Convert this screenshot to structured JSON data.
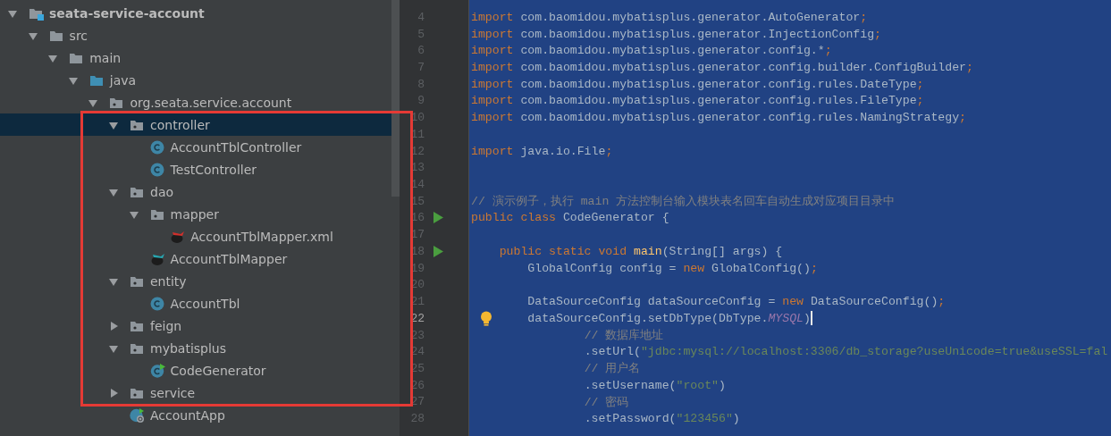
{
  "project_tree": [
    {
      "label": "seata-service-account",
      "kind": "module",
      "expanded": true,
      "selected": false,
      "children": [
        {
          "label": "src",
          "kind": "folder",
          "expanded": true,
          "selected": false,
          "children": [
            {
              "label": "main",
              "kind": "folder",
              "expanded": true,
              "selected": false,
              "children": [
                {
                  "label": "java",
                  "kind": "source-folder",
                  "expanded": true,
                  "selected": false,
                  "children": [
                    {
                      "label": "org.seata.service.account",
                      "kind": "package",
                      "expanded": true,
                      "selected": false,
                      "children": [
                        {
                          "label": "controller",
                          "kind": "package",
                          "expanded": true,
                          "selected": true,
                          "children": [
                            {
                              "label": "AccountTblController",
                              "kind": "class",
                              "selected": false
                            },
                            {
                              "label": "TestController",
                              "kind": "class",
                              "selected": false
                            }
                          ]
                        },
                        {
                          "label": "dao",
                          "kind": "package",
                          "expanded": true,
                          "selected": false,
                          "children": [
                            {
                              "label": "mapper",
                              "kind": "package",
                              "expanded": true,
                              "selected": false,
                              "children": [
                                {
                                  "label": "AccountTblMapper.xml",
                                  "kind": "mybatis-xml",
                                  "selected": false
                                }
                              ]
                            },
                            {
                              "label": "AccountTblMapper",
                              "kind": "mybatis-mapper",
                              "selected": false
                            }
                          ]
                        },
                        {
                          "label": "entity",
                          "kind": "package",
                          "expanded": true,
                          "selected": false,
                          "children": [
                            {
                              "label": "AccountTbl",
                              "kind": "class",
                              "selected": false
                            }
                          ]
                        },
                        {
                          "label": "feign",
                          "kind": "package",
                          "expanded": false,
                          "selected": false
                        },
                        {
                          "label": "mybatisplus",
                          "kind": "package",
                          "expanded": true,
                          "selected": false,
                          "children": [
                            {
                              "label": "CodeGenerator",
                              "kind": "runnable-class",
                              "selected": false
                            }
                          ]
                        },
                        {
                          "label": "service",
                          "kind": "package",
                          "expanded": false,
                          "selected": false
                        },
                        {
                          "label": "AccountApp",
                          "kind": "spring-app",
                          "selected": false
                        }
                      ]
                    }
                  ]
                }
              ]
            }
          ]
        }
      ]
    }
  ],
  "editor": {
    "lines": [
      {
        "number": "4",
        "run": false,
        "bulb": false,
        "current": false,
        "tokens": [
          {
            "kind": "keyword",
            "text": "import"
          },
          {
            "kind": "plain",
            "text": " com.baomidou.mybatisplus.generator.AutoGenerator"
          },
          {
            "kind": "keyword",
            "text": ";"
          }
        ]
      },
      {
        "number": "5",
        "run": false,
        "bulb": false,
        "current": false,
        "tokens": [
          {
            "kind": "keyword",
            "text": "import"
          },
          {
            "kind": "plain",
            "text": " com.baomidou.mybatisplus.generator.InjectionConfig"
          },
          {
            "kind": "keyword",
            "text": ";"
          }
        ]
      },
      {
        "number": "6",
        "run": false,
        "bulb": false,
        "current": false,
        "tokens": [
          {
            "kind": "keyword",
            "text": "import"
          },
          {
            "kind": "plain",
            "text": " com.baomidou.mybatisplus.generator.config.*"
          },
          {
            "kind": "keyword",
            "text": ";"
          }
        ]
      },
      {
        "number": "7",
        "run": false,
        "bulb": false,
        "current": false,
        "tokens": [
          {
            "kind": "keyword",
            "text": "import"
          },
          {
            "kind": "plain",
            "text": " com.baomidou.mybatisplus.generator.config.builder.ConfigBuilder"
          },
          {
            "kind": "keyword",
            "text": ";"
          }
        ]
      },
      {
        "number": "8",
        "run": false,
        "bulb": false,
        "current": false,
        "tokens": [
          {
            "kind": "keyword",
            "text": "import"
          },
          {
            "kind": "plain",
            "text": " com.baomidou.mybatisplus.generator.config.rules.DateType"
          },
          {
            "kind": "keyword",
            "text": ";"
          }
        ]
      },
      {
        "number": "9",
        "run": false,
        "bulb": false,
        "current": false,
        "tokens": [
          {
            "kind": "keyword",
            "text": "import"
          },
          {
            "kind": "plain",
            "text": " com.baomidou.mybatisplus.generator.config.rules.FileType"
          },
          {
            "kind": "keyword",
            "text": ";"
          }
        ]
      },
      {
        "number": "10",
        "run": false,
        "bulb": false,
        "current": false,
        "tokens": [
          {
            "kind": "keyword",
            "text": "import"
          },
          {
            "kind": "plain",
            "text": " com.baomidou.mybatisplus.generator.config.rules.NamingStrategy"
          },
          {
            "kind": "keyword",
            "text": ";"
          }
        ]
      },
      {
        "number": "11",
        "run": false,
        "bulb": false,
        "current": false
      },
      {
        "number": "12",
        "run": false,
        "bulb": false,
        "current": false,
        "tokens": [
          {
            "kind": "keyword",
            "text": "import"
          },
          {
            "kind": "plain",
            "text": " java.io.File"
          },
          {
            "kind": "keyword",
            "text": ";"
          }
        ]
      },
      {
        "number": "13",
        "run": false,
        "bulb": false,
        "current": false
      },
      {
        "number": "14",
        "run": false,
        "bulb": false,
        "current": false
      },
      {
        "number": "15",
        "run": false,
        "bulb": false,
        "current": false,
        "tokens": [
          {
            "kind": "comment",
            "text": "// 演示例子，执行 main 方法控制台输入模块表名回车自动生成对应项目目录中"
          }
        ]
      },
      {
        "number": "16",
        "run": true,
        "bulb": false,
        "current": false,
        "tokens": [
          {
            "kind": "keyword",
            "text": "public class"
          },
          {
            "kind": "plain",
            "text": " CodeGenerator {"
          }
        ]
      },
      {
        "number": "17",
        "run": false,
        "bulb": false,
        "current": false
      },
      {
        "number": "18",
        "run": true,
        "bulb": false,
        "current": false,
        "tokens": [
          {
            "kind": "keyword",
            "text": "    public static void"
          },
          {
            "kind": "method",
            "text": " main"
          },
          {
            "kind": "plain",
            "text": "(String[] args) {"
          }
        ]
      },
      {
        "number": "19",
        "run": false,
        "bulb": false,
        "current": false,
        "tokens": [
          {
            "kind": "plain",
            "text": "        GlobalConfig config = "
          },
          {
            "kind": "keyword",
            "text": "new"
          },
          {
            "kind": "plain",
            "text": " GlobalConfig()"
          },
          {
            "kind": "keyword",
            "text": ";"
          }
        ]
      },
      {
        "number": "20",
        "run": false,
        "bulb": false,
        "current": false
      },
      {
        "number": "21",
        "run": false,
        "bulb": false,
        "current": false,
        "tokens": [
          {
            "kind": "plain",
            "text": "        DataSourceConfig dataSourceConfig = "
          },
          {
            "kind": "keyword",
            "text": "new"
          },
          {
            "kind": "plain",
            "text": " DataSourceConfig()"
          },
          {
            "kind": "keyword",
            "text": ";"
          }
        ]
      },
      {
        "number": "22",
        "run": false,
        "bulb": true,
        "current": true,
        "tokens": [
          {
            "kind": "plain",
            "text": "        dataSourceConfig.setDbType(DbType."
          },
          {
            "kind": "constant",
            "text": "MYSQL"
          },
          {
            "kind": "plain",
            "text": ")"
          }
        ]
      },
      {
        "number": "23",
        "run": false,
        "bulb": false,
        "current": false,
        "tokens": [
          {
            "kind": "comment",
            "text": "                // 数据库地址"
          }
        ]
      },
      {
        "number": "24",
        "run": false,
        "bulb": false,
        "current": false,
        "tokens": [
          {
            "kind": "plain",
            "text": "                .setUrl("
          },
          {
            "kind": "string",
            "text": "\"jdbc:mysql://localhost:3306/db_storage?useUnicode=true&useSSL=fal"
          }
        ]
      },
      {
        "number": "25",
        "run": false,
        "bulb": false,
        "current": false,
        "tokens": [
          {
            "kind": "comment",
            "text": "                // 用户名"
          }
        ]
      },
      {
        "number": "26",
        "run": false,
        "bulb": false,
        "current": false,
        "tokens": [
          {
            "kind": "plain",
            "text": "                .setUsername("
          },
          {
            "kind": "string",
            "text": "\"root\""
          },
          {
            "kind": "plain",
            "text": ")"
          }
        ]
      },
      {
        "number": "27",
        "run": false,
        "bulb": false,
        "current": false,
        "tokens": [
          {
            "kind": "comment",
            "text": "                // 密码"
          }
        ]
      },
      {
        "number": "28",
        "run": false,
        "bulb": false,
        "current": false,
        "tokens": [
          {
            "kind": "plain",
            "text": "                .setPassword("
          },
          {
            "kind": "string",
            "text": "\"123456\""
          },
          {
            "kind": "plain",
            "text": ")"
          }
        ]
      }
    ]
  }
}
